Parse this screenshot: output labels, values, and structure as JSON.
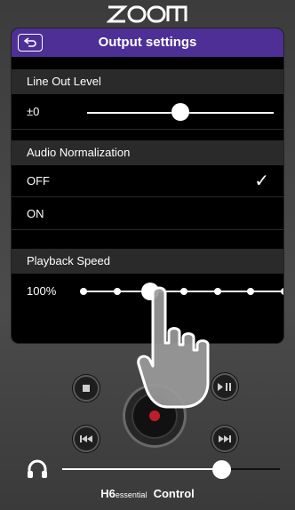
{
  "brand": {
    "logo_text": "ZOOM"
  },
  "header": {
    "title": "Output settings"
  },
  "sections": {
    "line_out": {
      "label": "Line Out Level",
      "value_label": "±0",
      "level_fraction": 0.5
    },
    "normalization": {
      "label": "Audio Normalization",
      "options": [
        {
          "label": "OFF",
          "selected": true
        },
        {
          "label": "ON",
          "selected": false
        }
      ],
      "check_glyph": "✓"
    },
    "playback": {
      "label": "Playback Speed",
      "value_label": "100%",
      "step_count": 7,
      "selected_step": 3
    }
  },
  "headphone": {
    "volume_fraction": 0.73
  },
  "footer": {
    "model": "H6",
    "edition": "essential",
    "suffix": "Control"
  },
  "colors": {
    "header": "#4e2f95",
    "record": "#c01d2b"
  },
  "icons": [
    "back-arrow-icon",
    "headphone-icon",
    "stop-icon",
    "play-pause-icon",
    "rewind-icon",
    "fast-forward-icon",
    "record-icon",
    "pointing-hand-icon"
  ]
}
